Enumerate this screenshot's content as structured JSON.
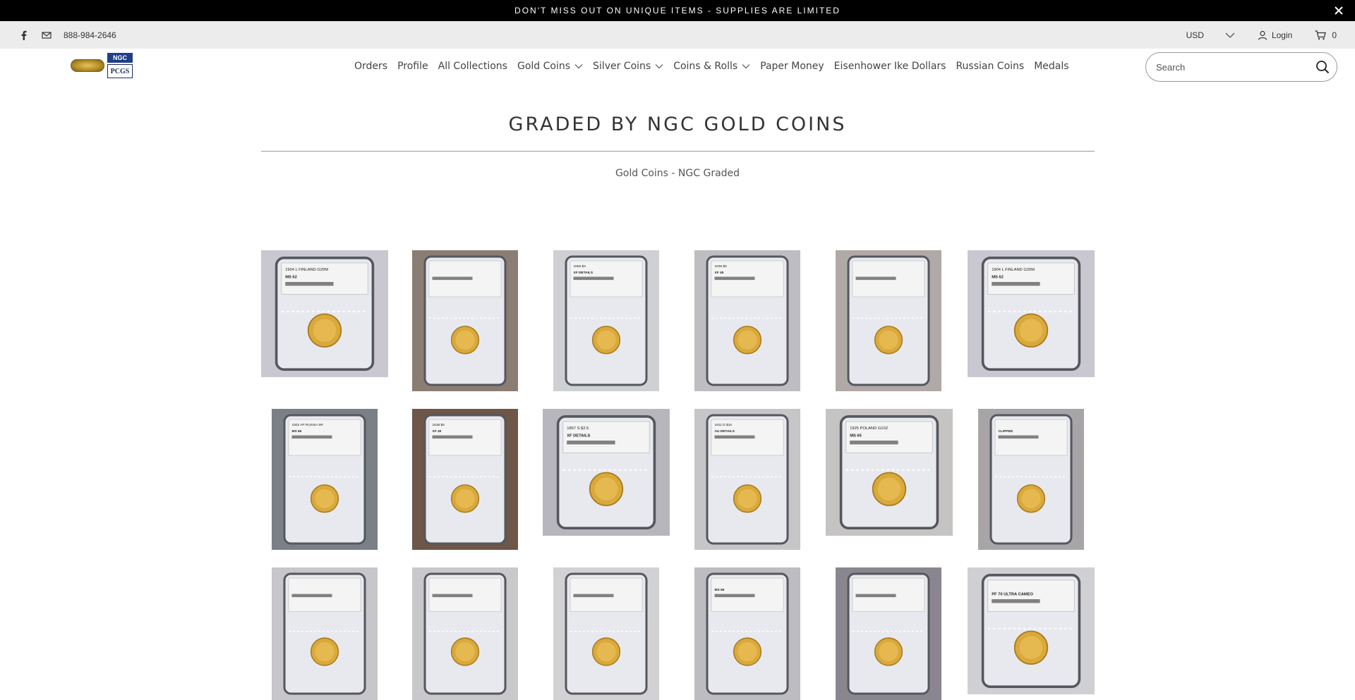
{
  "promo": {
    "text": "DON'T MISS OUT ON UNIQUE ITEMS - SUPPLIES ARE LIMITED"
  },
  "utility": {
    "phone": "888-984-2646",
    "currency": "USD",
    "login_label": "Login",
    "cart_count": "0"
  },
  "nav": {
    "items": [
      {
        "label": "Orders"
      },
      {
        "label": "Profile"
      },
      {
        "label": "All Collections"
      },
      {
        "label": "Gold Coins"
      },
      {
        "label": "Silver Coins"
      },
      {
        "label": "Coins & Rolls"
      },
      {
        "label": "Paper Money"
      },
      {
        "label": "Eisenhower Ike Dollars"
      },
      {
        "label": "Russian Coins"
      },
      {
        "label": "Medals"
      }
    ]
  },
  "search": {
    "placeholder": "Search"
  },
  "collection": {
    "title": "GRADED BY NGC GOLD COINS",
    "description": "Gold Coins - NGC Graded"
  },
  "products": [
    {
      "label": "1904 L FINLAND G20M",
      "grade": "MS 62"
    },
    {
      "label": "",
      "grade": ""
    },
    {
      "label": "1856 $3",
      "grade": "XF DETAILS"
    },
    {
      "label": "1836 $5",
      "grade": "XF 45"
    },
    {
      "label": "",
      "grade": ""
    },
    {
      "label": "1904 L FINLAND G20M",
      "grade": "MS 62"
    },
    {
      "label": "1902 AP RUSSIA 5R",
      "grade": "MS 66"
    },
    {
      "label": "1838 $5",
      "grade": "XF 40"
    },
    {
      "label": "1867 S $2.5",
      "grade": "XF DETAILS"
    },
    {
      "label": "1911 D $10",
      "grade": "AU DETAILS"
    },
    {
      "label": "1925 POLAND G10Z",
      "grade": "MS 65"
    },
    {
      "label": "",
      "grade": "CLIPPED"
    },
    {
      "label": "",
      "grade": ""
    },
    {
      "label": "",
      "grade": ""
    },
    {
      "label": "",
      "grade": ""
    },
    {
      "label": "",
      "grade": "MS 66"
    },
    {
      "label": "",
      "grade": ""
    },
    {
      "label": "",
      "grade": "PF 70 ULTRA CAMEO"
    }
  ]
}
